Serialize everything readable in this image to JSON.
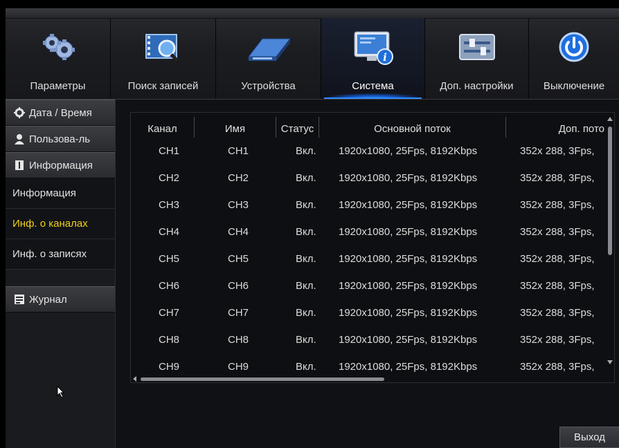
{
  "nav": {
    "tabs": [
      {
        "label": "Параметры",
        "icon": "gears-icon"
      },
      {
        "label": "Поиск записей",
        "icon": "film-search-icon"
      },
      {
        "label": "Устройства",
        "icon": "hdd-icon"
      },
      {
        "label": "Система",
        "icon": "monitor-info-icon",
        "active": true
      },
      {
        "label": "Доп. настройки",
        "icon": "sliders-icon"
      },
      {
        "label": "Выключение",
        "icon": "power-icon"
      }
    ]
  },
  "sidebar": {
    "items": [
      {
        "label": "Дата / Время",
        "type": "main",
        "icon": "gear-icon"
      },
      {
        "label": "Пользова-ль",
        "type": "main",
        "icon": "user-icon"
      },
      {
        "label": "Информация",
        "type": "main",
        "icon": "info-book-icon"
      },
      {
        "label": "Информация",
        "type": "sub"
      },
      {
        "label": "Инф. о каналах",
        "type": "sub",
        "selected": true
      },
      {
        "label": "Инф. о записях",
        "type": "sub"
      },
      {
        "label": "Журнал",
        "type": "main",
        "icon": "log-icon"
      }
    ]
  },
  "table": {
    "headers": [
      "Канал",
      "Имя",
      "Статус",
      "Основной поток",
      "Доп. пото"
    ],
    "rows": [
      [
        "CH1",
        "CH1",
        "Вкл.",
        "1920x1080, 25Fps,  8192Kbps",
        "352x 288,  3Fps,"
      ],
      [
        "CH2",
        "CH2",
        "Вкл.",
        "1920x1080, 25Fps,  8192Kbps",
        "352x 288,  3Fps,"
      ],
      [
        "CH3",
        "CH3",
        "Вкл.",
        "1920x1080, 25Fps,  8192Kbps",
        "352x 288,  3Fps,"
      ],
      [
        "CH4",
        "CH4",
        "Вкл.",
        "1920x1080, 25Fps,  8192Kbps",
        "352x 288,  3Fps,"
      ],
      [
        "CH5",
        "CH5",
        "Вкл.",
        "1920x1080, 25Fps,  8192Kbps",
        "352x 288,  3Fps,"
      ],
      [
        "CH6",
        "CH6",
        "Вкл.",
        "1920x1080, 25Fps,  8192Kbps",
        "352x 288,  3Fps,"
      ],
      [
        "CH7",
        "CH7",
        "Вкл.",
        "1920x1080, 25Fps,  8192Kbps",
        "352x 288,  3Fps,"
      ],
      [
        "CH8",
        "CH8",
        "Вкл.",
        "1920x1080, 25Fps,  8192Kbps",
        "352x 288,  3Fps,"
      ],
      [
        "CH9",
        "CH9",
        "Вкл.",
        "1920x1080, 25Fps,  8192Kbps",
        "352x 288,  3Fps,"
      ]
    ]
  },
  "footer": {
    "exit_label": "Выход"
  },
  "colors": {
    "accent": "#2d8cff",
    "selected_text": "#f2d21a"
  }
}
